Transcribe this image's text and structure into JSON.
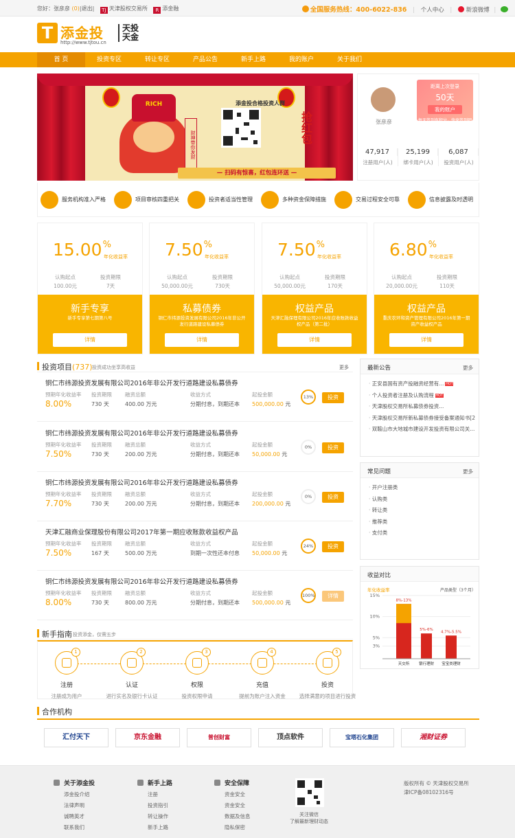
{
  "topbar": {
    "greeting": "您好：张彦彦",
    "msg_count": "(0)",
    "logout": "|退出|",
    "exchange": "天津股权交易所",
    "partner": "添金融",
    "hotline": "全国服务热线：400-6022-836",
    "personal": "个人中心",
    "weibo": "新浪微博"
  },
  "logo": {
    "mark": "T",
    "name": "添金投",
    "url": "http://www.tjtou.cn",
    "slogan": "天投天金"
  },
  "nav": [
    "首 页",
    "投资专区",
    "转让专区",
    "产品公告",
    "新手上路",
    "我的账户",
    "关于我们"
  ],
  "banner": {
    "rich": "RICH",
    "qr_title": "添金投合格投资人群",
    "bottom": "— 扫码有惊喜，红包连环送 —",
    "red_packet": "抢红包",
    "scroll": "财神带你发财",
    "lantern_char": "财"
  },
  "user": {
    "name": "张彦彦",
    "since": "距离上次登录",
    "days": "50天",
    "account_btn": "我的账户",
    "tip": "每天签到有积分，快来签到吧",
    "stats": [
      {
        "num": "47,917",
        "label": "注册用户(人)"
      },
      {
        "num": "25,199",
        "label": "绑卡用户(人)"
      },
      {
        "num": "6,087",
        "label": "投资用户(人)"
      }
    ]
  },
  "features": [
    "服务机构准入严格",
    "项目审核四重把关",
    "投资者适当性管理",
    "多种资金保障措施",
    "交易过程安全可靠",
    "信息披露及时透明"
  ],
  "products": [
    {
      "rate": "15.00",
      "unit": "%",
      "rate_label": "年化收益率",
      "min_label": "认购起点",
      "min": "100.00元",
      "term_label": "投资期限",
      "term": "7天",
      "name": "新手专享",
      "desc": "新手专享第七期第八号",
      "btn": "详情"
    },
    {
      "rate": "7.50",
      "unit": "%",
      "rate_label": "年化收益率",
      "min_label": "认购起点",
      "min": "50,000.00元",
      "term_label": "投资期限",
      "term": "730天",
      "name": "私募债券",
      "desc": "铜仁市纬源投资发展有限公司2016年非公开发行道路建设私募债券",
      "btn": "详情"
    },
    {
      "rate": "7.50",
      "unit": "%",
      "rate_label": "年化收益率",
      "min_label": "认购起点",
      "min": "50,000.00元",
      "term_label": "投资期限",
      "term": "170天",
      "name": "权益产品",
      "desc": "天津汇融保理有限公司2016年应收账款收益权产品（第二批）",
      "btn": "详情"
    },
    {
      "rate": "6.80",
      "unit": "%",
      "rate_label": "年化收益率",
      "min_label": "认购起点",
      "min": "20,000.00元",
      "term_label": "投资期限",
      "term": "110天",
      "name": "权益产品",
      "desc": "重庆农环和资产管理有限公司2016年第一期资产收益权产品",
      "btn": "详情"
    }
  ],
  "invest": {
    "title": "投资项目",
    "count": "(737)",
    "sub": "投资成功坐享高收益",
    "more": "更多",
    "labels": {
      "rate": "预期年化收益率",
      "term": "投资期限",
      "amount": "融资总额",
      "method": "收益方式",
      "min": "起投金额"
    },
    "items": [
      {
        "name": "铜仁市纬源投资发展有限公司2016年非公开发行道路建设私募债券",
        "rate": "8.00%",
        "term": "730 天",
        "amount": "400.00 万元",
        "method": "分期付息，到期还本",
        "min": "500,000.00",
        "yuan": "元",
        "progress": "13%",
        "btn": "投资"
      },
      {
        "name": "铜仁市纬源投资发展有限公司2016年非公开发行道路建设私募债券",
        "rate": "7.50%",
        "term": "730 天",
        "amount": "200.00 万元",
        "method": "分期付息，到期还本",
        "min": "50,000.00",
        "yuan": "元",
        "progress": "0%",
        "btn": "投资"
      },
      {
        "name": "铜仁市纬源投资发展有限公司2016年非公开发行道路建设私募债券",
        "rate": "7.70%",
        "term": "730 天",
        "amount": "200.00 万元",
        "method": "分期付息，到期还本",
        "min": "200,000.00",
        "yuan": "元",
        "progress": "0%",
        "btn": "投资"
      },
      {
        "name": "天津汇融商业保理股份有限公司2017年第一期应收账款收益权产品",
        "rate": "7.50%",
        "term": "167 天",
        "amount": "500.00 万元",
        "method": "到期一次性还本付息",
        "min": "50,000.00",
        "yuan": "元",
        "progress": "24%",
        "btn": "投资"
      },
      {
        "name": "铜仁市纬源投资发展有限公司2016年非公开发行道路建设私募债券",
        "rate": "8.00%",
        "term": "730 天",
        "amount": "800.00 万元",
        "method": "分期付息，到期还本",
        "min": "500,000.00",
        "yuan": "元",
        "progress": "100%",
        "btn": "详情"
      }
    ]
  },
  "notice": {
    "title": "最新公告",
    "more": "更多",
    "items": [
      "正安县国有资产投融资经营有...",
      "个人投资者注册及认购流程",
      "天津股权交易所私募债券投资...",
      "天津股权交易所新私募债券接受备案通知书[2...",
      "双鞍山市大地城市建设开发投资有限公司关..."
    ],
    "hot_label": "HOT"
  },
  "faq": {
    "title": "常见问题",
    "more": "更多",
    "items": [
      "开户注册类",
      "认购类",
      "转让类",
      "推荐类",
      "支付类"
    ]
  },
  "compare": {
    "title": "收益对比"
  },
  "chart_data": {
    "type": "bar",
    "title": "",
    "ylabel": "年化收益率",
    "legend": "产品类型（3个月）",
    "categories": [
      "天交所",
      "银行理财",
      "宝宝类理财"
    ],
    "ranges": [
      "8%-13%",
      "5%-6%",
      "4.7%-5.5%"
    ],
    "yticks": [
      "15%",
      "10%",
      "5%",
      "3%"
    ],
    "values": [
      13,
      6,
      5.5
    ],
    "ylim": [
      0,
      15
    ]
  },
  "guide": {
    "title": "新手指南",
    "sub": "投资添金，仅需五步",
    "steps": [
      {
        "n": "1",
        "title": "注册",
        "desc": "注册成为用户"
      },
      {
        "n": "2",
        "title": "认证",
        "desc": "进行实名及银行卡认证"
      },
      {
        "n": "3",
        "title": "权限",
        "desc": "投资权限申请"
      },
      {
        "n": "4",
        "title": "充值",
        "desc": "提前为账户注入资金"
      },
      {
        "n": "5",
        "title": "投资",
        "desc": "选择满意的项目进行投资"
      }
    ]
  },
  "partners": {
    "title": "合作机构",
    "items": [
      "汇付天下",
      "京东金融",
      "普创财富",
      "顶点软件",
      "宝塔石化集团",
      "湘财证券"
    ]
  },
  "footer": {
    "cols": [
      {
        "title": "关于添金投",
        "items": [
          "添金投介绍",
          "法律声明",
          "诚聘英才",
          "联系我们"
        ]
      },
      {
        "title": "新手上路",
        "items": [
          "注册",
          "投资指引",
          "转让操作",
          "新手上路"
        ]
      },
      {
        "title": "安全保障",
        "items": [
          "资金安全",
          "资金安全",
          "数据及信息",
          "隐私保密"
        ]
      }
    ],
    "qr1": "关注微信",
    "qr2": "了解最新理财动态",
    "copy1": "版权所有 © 天津股权交易所",
    "copy2": "津ICP备08102316号"
  },
  "colors": {
    "brand": "#f5a300",
    "dark": "#e48b00",
    "red": "#d41a1a"
  }
}
